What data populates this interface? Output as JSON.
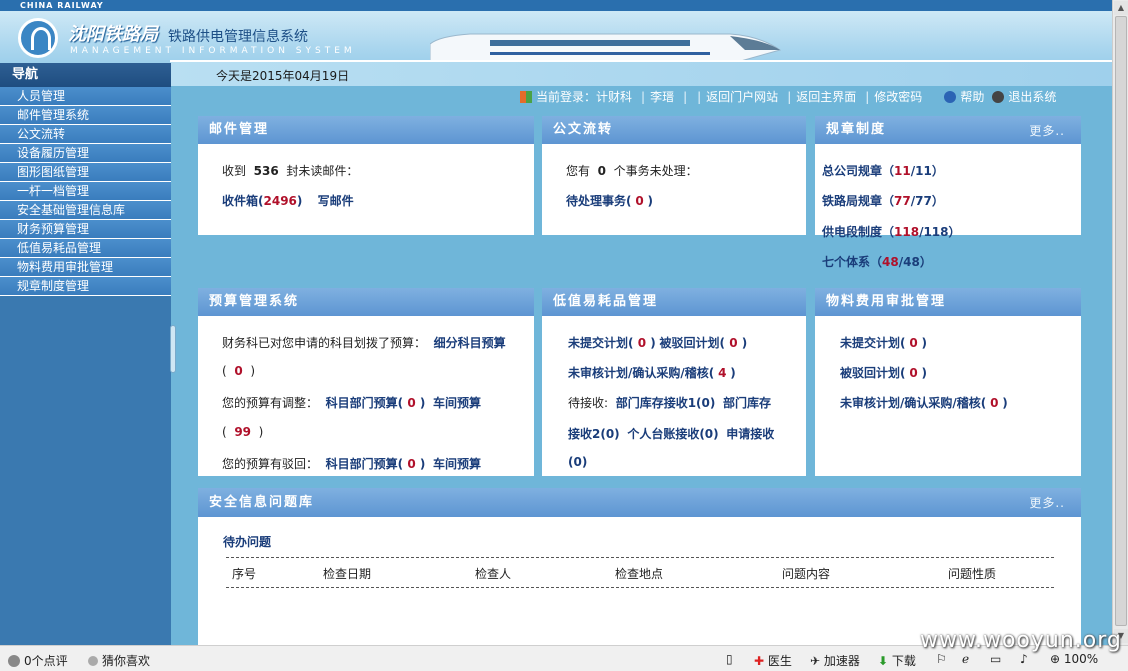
{
  "header": {
    "railway_brand": "CHINA RAILWAY",
    "bureau_name": "沈阳铁路局",
    "system_name": "铁路供电管理信息系统",
    "system_name_en": "MANAGEMENT INFORMATION SYSTEM",
    "today": "今天是2015年04月19日"
  },
  "toplinks": {
    "current_login": "当前登录：计财科",
    "user": "李瑨",
    "portal": "返回门户网站",
    "main": "返回主界面",
    "change_password": "修改密码",
    "help": "帮助",
    "logout": "退出系统"
  },
  "nav": {
    "title": "导航",
    "items": [
      "人员管理",
      "邮件管理系统",
      "公文流转",
      "设备履历管理",
      "图形图纸管理",
      "一杆一档管理",
      "安全基础管理信息库",
      "财务预算管理",
      "低值易耗品管理",
      "物料费用审批管理",
      "规章制度管理"
    ]
  },
  "mail": {
    "title": "邮件管理",
    "received_prefix": "收到",
    "unread_count": "536",
    "received_suffix": "封未读邮件：",
    "inbox_label": "收件箱(",
    "inbox_count": "2496",
    "inbox_close": ")",
    "compose": "写邮件"
  },
  "docs": {
    "title": "公文流转",
    "pending_prefix": "您有",
    "pending_count": "0",
    "pending_suffix": "个事务未处理：",
    "pending_link": "待处理事务(",
    "pending_link_count": "0",
    "pending_link_close": ")"
  },
  "rules": {
    "title": "规章制度",
    "more": "更多..",
    "items": [
      {
        "label": "总公司规章（",
        "a": "11",
        "b": "/11",
        "close": "）"
      },
      {
        "label": "铁路局规章（",
        "a": "77",
        "b": "/77",
        "close": "）"
      },
      {
        "label": "供电段制度（",
        "a": "118",
        "b": "/118",
        "close": "）"
      },
      {
        "label": "七个体系（",
        "a": "48",
        "b": "/48",
        "close": "）"
      }
    ]
  },
  "budget": {
    "title": "预算管理系统",
    "line1_text": "财务科已对您申请的科目划拨了预算：",
    "line1_link": "细分科目预算",
    "line2_open": "(",
    "line2_num": "0",
    "line2_close": ")",
    "line3_text": "您的预算有调整：",
    "line3_link1": "科目部门预算(",
    "line3_num": "0",
    "line3_mid": ")",
    "line3_link2": "车间预算",
    "line4_open": "(",
    "line4_num": "99",
    "line4_close": ")",
    "line5_text": "您的预算有驳回：",
    "line5_link1": "科目部门预算(",
    "line5_num": "0",
    "line5_mid": ")",
    "line5_link2": "车间预算"
  },
  "consumables": {
    "title": "低值易耗品管理",
    "l1a": "未提交计划(",
    "l1a_n": "0",
    "l1a_c": ")",
    "l1b": "被驳回计划(",
    "l1b_n": "0",
    "l1b_c": ")",
    "l2a": "未审核计划/确认采购/稽核(",
    "l2a_n": "4",
    "l2a_c": ")",
    "l3_text": "待接收:",
    "l3a": "部门库存接收1(0)",
    "l3b": "部门库存",
    "l4a": "接收2(0)",
    "l4b": "个人台账接收(0)",
    "l4c": "申请接收",
    "l5": "(0)"
  },
  "materials": {
    "title": "物料费用审批管理",
    "l1": "未提交计划(",
    "l1_n": "0",
    "l1_c": ")",
    "l2": "被驳回计划(",
    "l2_n": "0",
    "l2_c": ")",
    "l3": "未审核计划/确认采购/稽核(",
    "l3_n": "0",
    "l3_c": ")"
  },
  "safety": {
    "title": "安全信息问题库",
    "more": "更多..",
    "pending_title": "待办问题",
    "columns": [
      "序号",
      "检查日期",
      "检查人",
      "检查地点",
      "问题内容",
      "问题性质"
    ]
  },
  "statusbar": {
    "comments": "0个点评",
    "guess": "猜你喜欢",
    "doctor": "医生",
    "accelerator": "加速器",
    "download": "下载",
    "zoom": "100%"
  },
  "watermark": "www.wooyun.org"
}
